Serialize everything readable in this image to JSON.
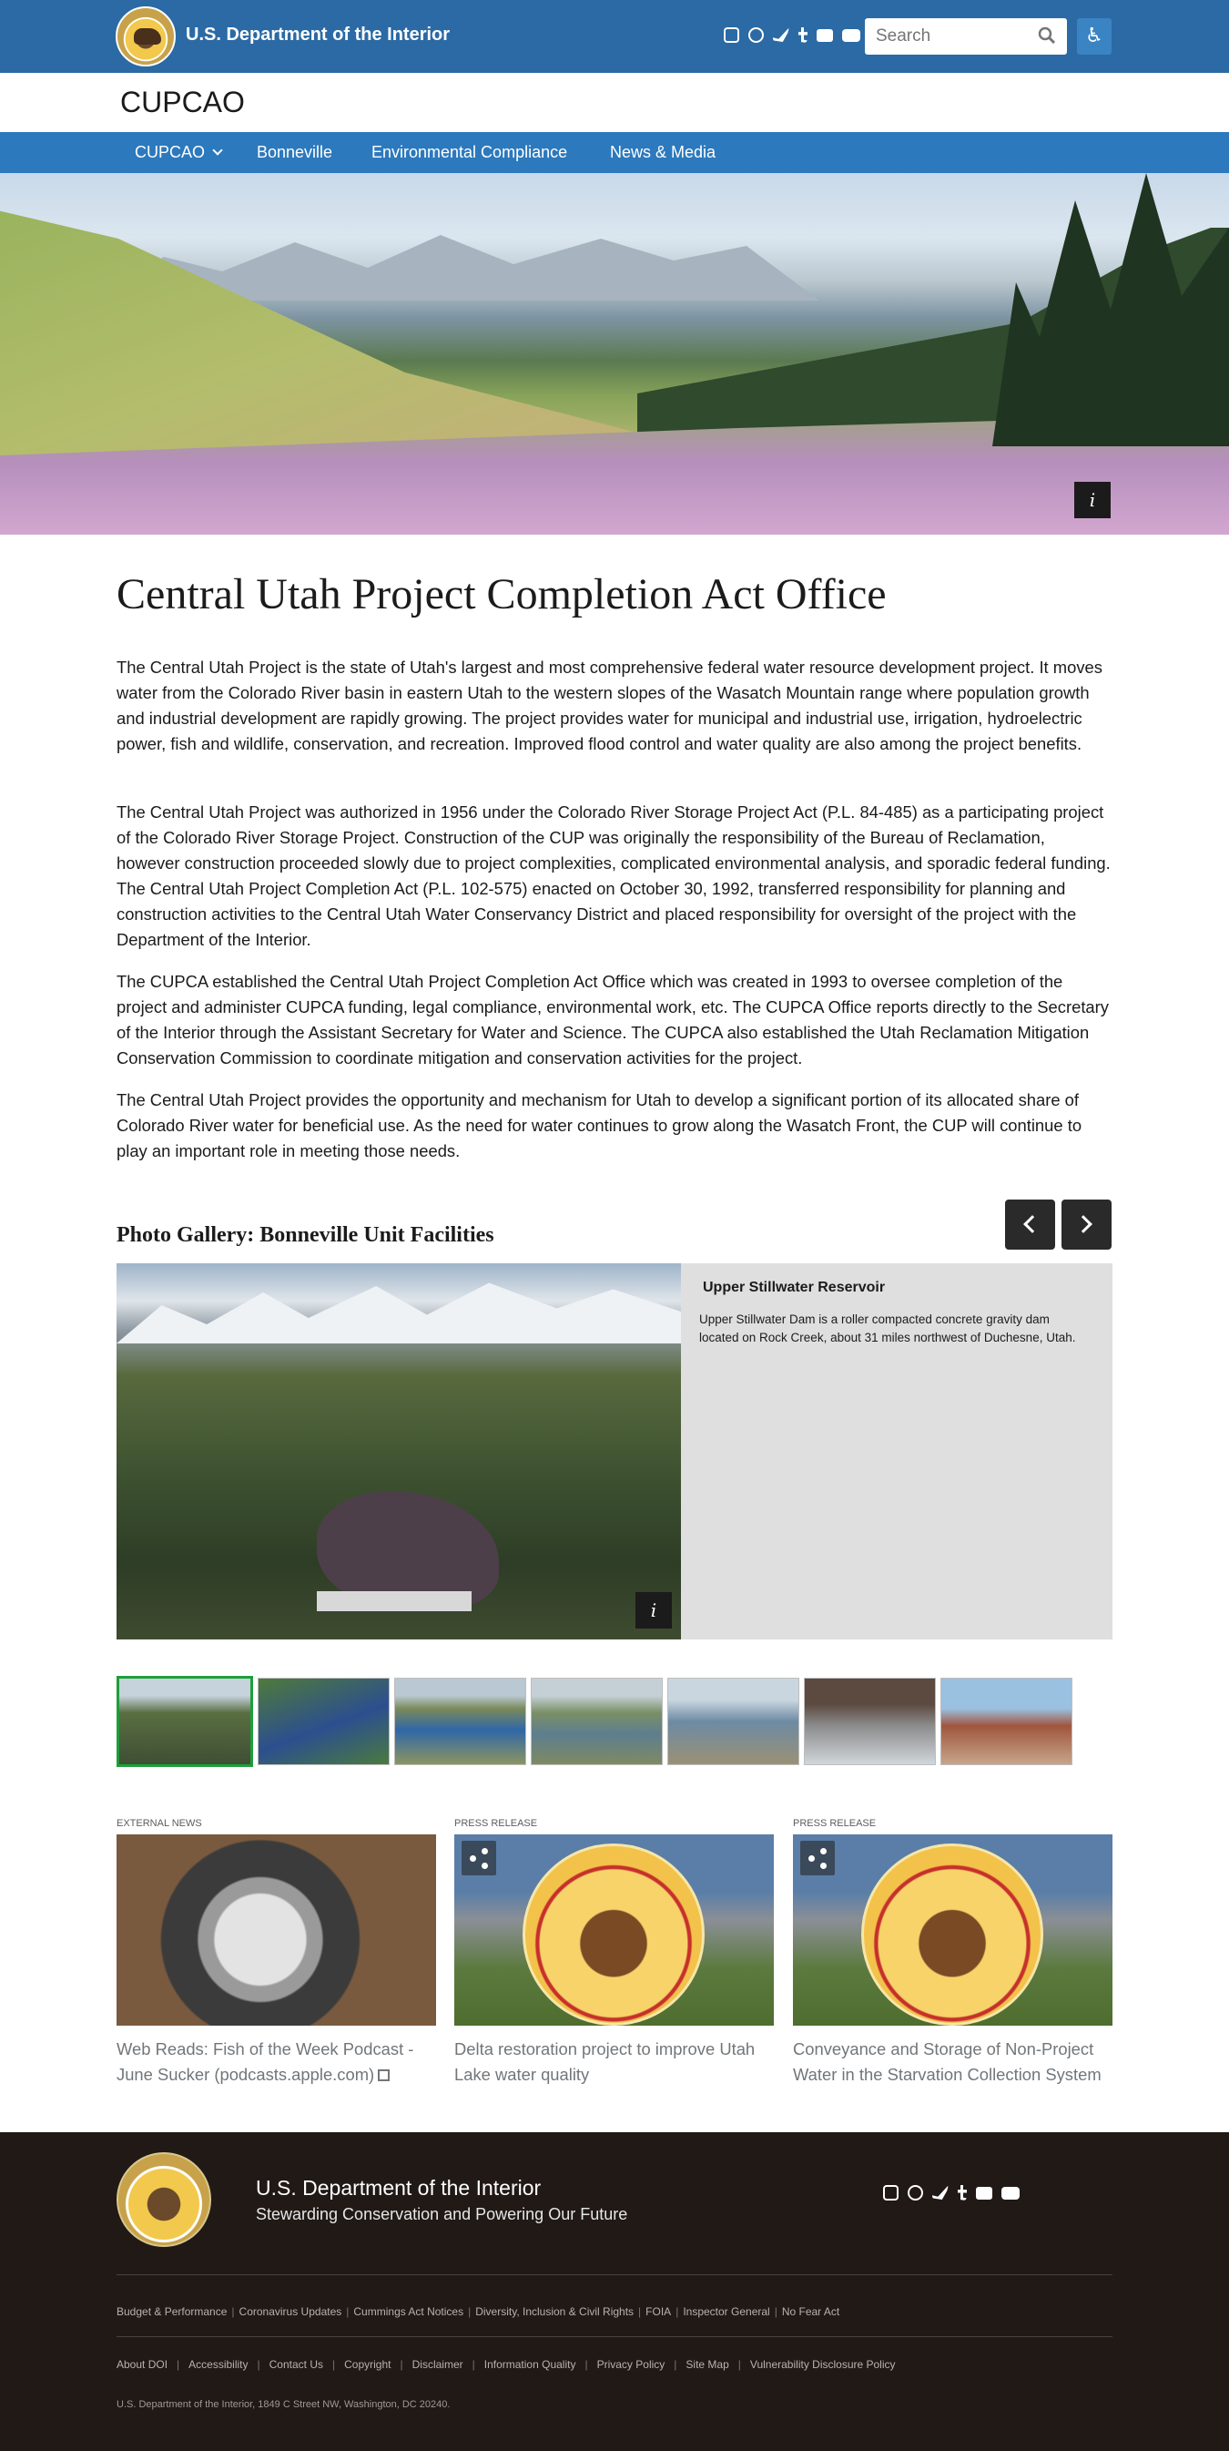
{
  "header": {
    "site_name": "U.S. Department of the Interior",
    "social_icons": [
      "instagram-icon",
      "facebook-icon",
      "twitter-icon",
      "tumblr-icon",
      "flickr-icon",
      "youtube-icon"
    ],
    "search": {
      "placeholder": "Search"
    },
    "accessibility_icon": "wheelchair-icon",
    "brand_color": "#2b6aa4"
  },
  "office": {
    "name": "CUPCAO"
  },
  "nav": {
    "items": [
      {
        "label": "CUPCAO",
        "has_dropdown": true
      },
      {
        "label": "Bonneville"
      },
      {
        "label": "Environmental Compliance"
      },
      {
        "label": "News & Media"
      }
    ],
    "color": "#2c79bd"
  },
  "hero": {
    "info_label": "i"
  },
  "main": {
    "title": "Central Utah Project Completion Act Office",
    "paragraphs": [
      "The Central Utah Project is the state of Utah's largest and most comprehensive federal water resource development project. It moves water from the Colorado River basin in eastern Utah to the western slopes of the Wasatch Mountain range where population growth and industrial development are rapidly growing. The project provides water for municipal and industrial use, irrigation, hydroelectric power, fish and wildlife, conservation, and recreation. Improved flood control and water quality are also among the project benefits.",
      "The Central Utah Project was authorized in 1956 under the Colorado River Storage Project Act (P.L. 84-485) as a participating project of the Colorado River Storage Project. Construction of the CUP was originally the responsibility of the Bureau of Reclamation, however construction proceeded slowly due to project complexities, complicated environmental analysis, and sporadic federal funding. The Central Utah Project Completion Act (P.L. 102-575) enacted on October 30, 1992, transferred responsibility for planning and construction activities to the Central Utah Water Conservancy District and placed responsibility for oversight of the project with the Department of the Interior.",
      "The CUPCA established the Central Utah Project Completion Act Office which was created in 1993 to oversee completion of the project and administer CUPCA funding, legal compliance, environmental work, etc. The CUPCA Office reports directly to the Secretary of the Interior through the Assistant Secretary for Water and Science. The CUPCA also established the Utah Reclamation Mitigation Conservation Commission to coordinate mitigation and conservation activities for the project.",
      "The Central Utah Project provides the opportunity and mechanism for Utah to develop a significant portion of its allocated share of Colorado River water for beneficial use. As the need for water continues to grow along the Wasatch Front, the CUP will continue to play an important role in meeting those needs."
    ]
  },
  "gallery": {
    "title": "Photo Gallery: Bonneville Unit Facilities",
    "current": {
      "caption_title": "Upper Stillwater Reservoir",
      "caption_text": "Upper Stillwater Dam is a roller compacted concrete gravity dam located on Rock Creek, about 31 miles northwest of Duchesne, Utah.",
      "info_label": "i"
    },
    "thumbnail_count": 7,
    "active_thumbnail": 1,
    "active_color": "#1e9e3a"
  },
  "news": [
    {
      "kind": "External News",
      "title": "Web Reads: Fish of the Week Podcast - June Sucker (podcasts.apple.com)",
      "external": true
    },
    {
      "kind": "Press Release",
      "title": "Delta restoration project to improve Utah Lake water quality",
      "share": true
    },
    {
      "kind": "Press Release",
      "title": "Conveyance and Storage of Non-Project Water in the Starvation Collection System",
      "share": true
    }
  ],
  "footer": {
    "org": "U.S. Department of the Interior",
    "tagline": "Stewarding Conservation and Powering Our Future",
    "links_row1": [
      "Budget & Performance",
      "Coronavirus Updates",
      "Cummings Act Notices",
      "Diversity, Inclusion & Civil Rights",
      "FOIA",
      "Inspector General",
      "No Fear Act"
    ],
    "links_row2": [
      "About DOI",
      "Accessibility",
      "Contact Us",
      "Copyright",
      "Disclaimer",
      "Information Quality",
      "Privacy Policy",
      "Site Map",
      "Vulnerability Disclosure Policy"
    ],
    "address": "U.S. Department of the Interior, 1849 C Street NW, Washington, DC 20240.",
    "background": "#211916"
  }
}
